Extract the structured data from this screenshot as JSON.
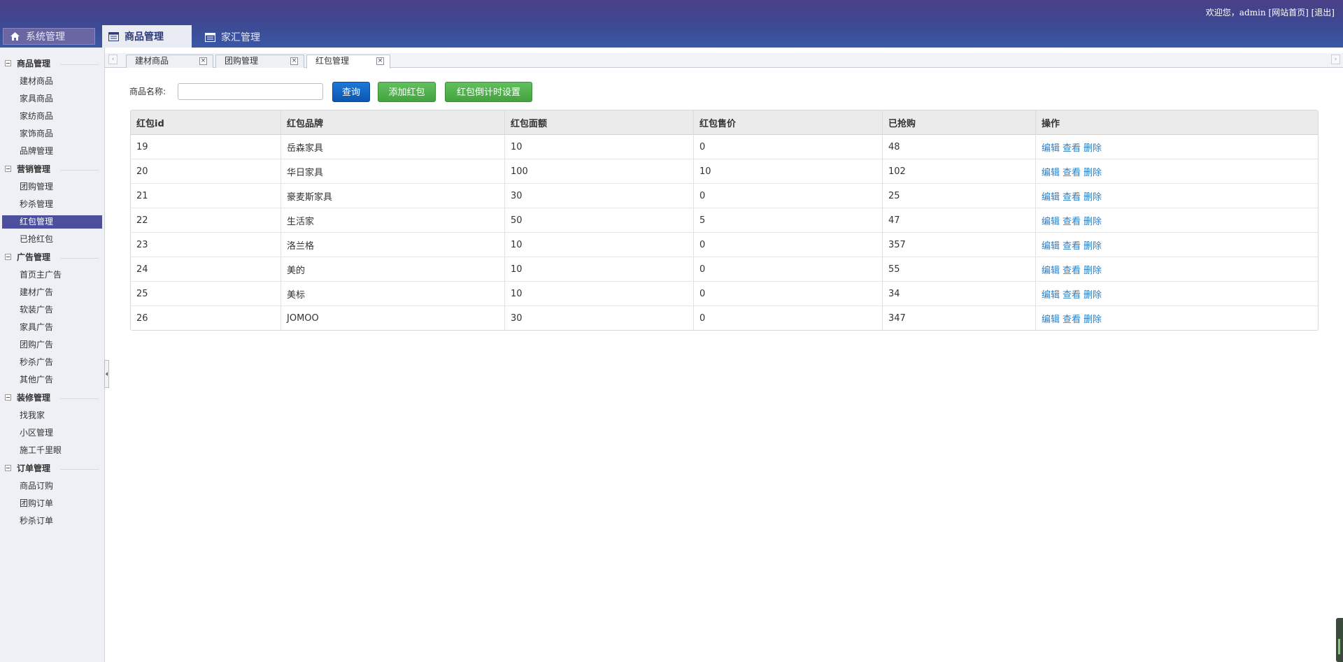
{
  "header": {
    "welcome_prefix": "欢迎您，admin",
    "home_link": "[网站首页]",
    "logout_link": "[退出]",
    "nav": [
      {
        "label": "系统管理",
        "icon": "home-icon"
      },
      {
        "label": "商品管理",
        "icon": "list-icon",
        "active": true
      },
      {
        "label": "家汇管理",
        "icon": "list-icon"
      }
    ]
  },
  "sidebar": {
    "groups": [
      {
        "title": "商品管理",
        "items": [
          "建材商品",
          "家具商品",
          "家纺商品",
          "家饰商品",
          "品牌管理"
        ]
      },
      {
        "title": "营销管理",
        "items": [
          "团购管理",
          "秒杀管理",
          "红包管理",
          "已抢红包"
        ]
      },
      {
        "title": "广告管理",
        "items": [
          "首页主广告",
          "建材广告",
          "软装广告",
          "家具广告",
          "团购广告",
          "秒杀广告",
          "其他广告"
        ]
      },
      {
        "title": "装修管理",
        "items": [
          "找我家",
          "小区管理",
          "施工千里眼"
        ]
      },
      {
        "title": "订单管理",
        "items": [
          "商品订购",
          "团购订单",
          "秒杀订单"
        ]
      }
    ],
    "active_item": "红包管理"
  },
  "tabs": [
    {
      "label": "建材商品"
    },
    {
      "label": "团购管理"
    },
    {
      "label": "红包管理",
      "active": true
    }
  ],
  "search": {
    "label": "商品名称:",
    "value": "",
    "query_button": "查询",
    "add_button": "添加红包",
    "countdown_button": "红包倒计时设置"
  },
  "table": {
    "columns": [
      "红包id",
      "红包品牌",
      "红包面额",
      "红包售价",
      "已抢购",
      "操作"
    ],
    "rows": [
      [
        "19",
        "岳森家具",
        "10",
        "0",
        "48"
      ],
      [
        "20",
        "华日家具",
        "100",
        "10",
        "102"
      ],
      [
        "21",
        "豪麦斯家具",
        "30",
        "0",
        "25"
      ],
      [
        "22",
        "生活家",
        "50",
        "5",
        "47"
      ],
      [
        "23",
        "洛兰格",
        "10",
        "0",
        "357"
      ],
      [
        "24",
        "美的",
        "10",
        "0",
        "55"
      ],
      [
        "25",
        "美标",
        "10",
        "0",
        "34"
      ],
      [
        "26",
        "JOMOO",
        "30",
        "0",
        "347"
      ]
    ],
    "actions": [
      "编辑",
      "查看",
      "删除"
    ]
  },
  "colors": {
    "header_bg": "#3c4a94",
    "sidebar_active": "#4b4f9d",
    "link": "#2d7fc4",
    "btn_query": "#0c56b2",
    "btn_green": "#43a53f"
  }
}
